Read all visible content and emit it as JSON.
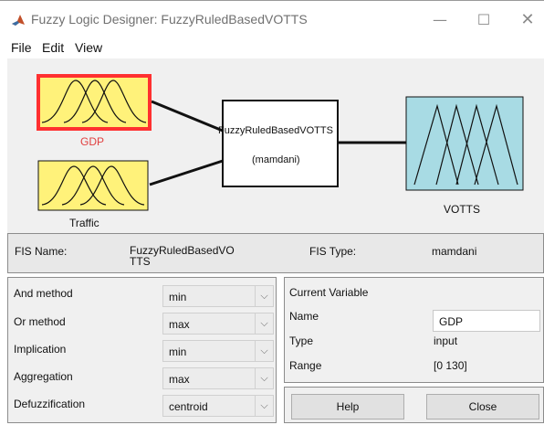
{
  "window": {
    "title": "Fuzzy Logic Designer: FuzzyRuledBasedVOTTS",
    "minimize_glyph": "—",
    "maximize_glyph": "☐",
    "close_glyph": "✕",
    "app_icon": "matlab-icon"
  },
  "menu": {
    "items": [
      "File",
      "Edit",
      "View"
    ]
  },
  "diagram": {
    "inputs": [
      {
        "label": "GDP",
        "selected": true,
        "label_color": "#e04040"
      },
      {
        "label": "Traffic",
        "selected": false,
        "label_color": "#111111"
      }
    ],
    "system": {
      "name": "FuzzyRuledBasedVOTTS",
      "type_label": "(mamdani)"
    },
    "output": {
      "label": "VOTTS"
    },
    "colors": {
      "input_fill": "#fff27a",
      "output_fill": "#a8dbe4",
      "selection": "#ff3030",
      "background": "#f0f0f0"
    }
  },
  "fis": {
    "name_label": "FIS Name:",
    "name_value": "FuzzyRuledBasedVOTTS",
    "type_label": "FIS Type:",
    "type_value": "mamdani"
  },
  "methods": [
    {
      "label": "And method",
      "value": "min"
    },
    {
      "label": "Or method",
      "value": "max"
    },
    {
      "label": "Implication",
      "value": "min"
    },
    {
      "label": "Aggregation",
      "value": "max"
    },
    {
      "label": "Defuzzification",
      "value": "centroid"
    }
  ],
  "current_variable": {
    "heading": "Current Variable",
    "name_label": "Name",
    "name_value": "GDP",
    "type_label": "Type",
    "type_value": "input",
    "range_label": "Range",
    "range_value": "[0 130]"
  },
  "buttons": {
    "help": "Help",
    "close": "Close"
  }
}
